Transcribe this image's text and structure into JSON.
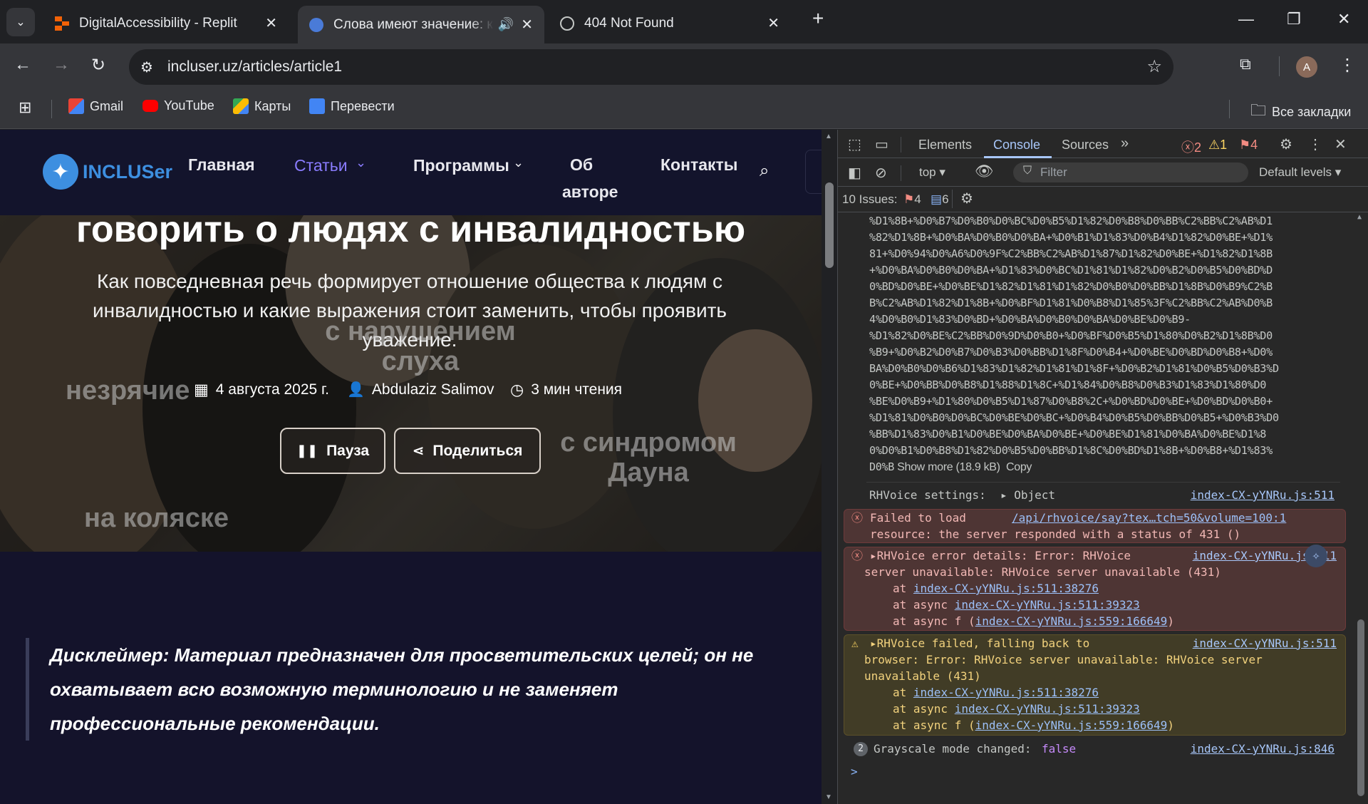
{
  "browser": {
    "tabs": [
      {
        "title": "DigitalAccessibility - Replit",
        "active": false
      },
      {
        "title": "Слова имеют значение: ка",
        "active": true
      },
      {
        "title": "404 Not Found",
        "active": false
      }
    ],
    "new_tab": "+",
    "url": "incluser.uz/articles/article1",
    "profile_initial": "A",
    "bookmarks": [
      "Gmail",
      "YouTube",
      "Карты",
      "Перевести"
    ],
    "all_bookmarks": "Все закладки"
  },
  "site": {
    "logo": "INCLUSer",
    "nav": [
      "Главная",
      "Статьи",
      "Программы",
      "Об",
      "авторе",
      "Контакты"
    ],
    "hero_title": "говорить о людях с инвалидностью",
    "hero_subtitle": "Как повседневная речь формирует отношение общества к людям с инвалидностью и какие выражения стоит заменить, чтобы проявить уважение.",
    "floating_words": [
      "с нарушением слуха",
      "незрячие",
      "с синдромом Дауна",
      "на коляске"
    ],
    "date": "4 августа 2025 г.",
    "author": "Abdulaziz Salimov",
    "read_time": "3 мин чтения",
    "pause_label": "Пауза",
    "share_label": "Поделиться",
    "disclaimer": "Дисклеймер: Материал предназначен для просветительских целей; он не охватывает всю возможную терминологию и не заменяет профессиональные рекомендации."
  },
  "devtools": {
    "tabs": [
      "Elements",
      "Console",
      "Sources"
    ],
    "active_tab": "Console",
    "error_count": "2",
    "warning_count": "1",
    "issue_badge": "4",
    "context": "top",
    "filter_placeholder": "Filter",
    "levels": "Default levels",
    "issues_label": "10 Issues:",
    "issues_errors": "4",
    "issues_info": "6",
    "encoded_lines": [
      "%D1%8B+%D0%B7%D0%B0%D0%BC%D0%B5%D1%82%D0%B8%D0%BB%C2%BB%C2%AB%D1",
      "%82%D1%8B+%D0%BA%D0%B0%D0%BA+%D0%B1%D1%83%D0%B4%D1%82%D0%BE+%D1%",
      "81+%D0%94%D0%A6%D0%9F%C2%BB%C2%AB%D1%87%D1%82%D0%BE+%D1%82%D1%8B",
      "+%D0%BA%D0%B0%D0%BA+%D1%83%D0%BC%D1%81%D1%82%D0%B2%D0%B5%D0%BD%D",
      "0%BD%D0%BE+%D0%BE%D1%82%D1%81%D1%82%D0%B0%D0%BB%D1%8B%D0%B9%C2%B",
      "B%C2%AB%D1%82%D1%8B+%D0%BF%D1%81%D0%B8%D1%85%3F%C2%BB%C2%AB%D0%B",
      "4%D0%B0%D1%83%D0%BD+%D0%BA%D0%B0%D0%BA%D0%BE%D0%B9-",
      "%D1%82%D0%BE%C2%BB%D0%9D%D0%B0+%D0%BF%D0%B5%D1%80%D0%B2%D1%8B%D0",
      "%B9+%D0%B2%D0%B7%D0%B3%D0%BB%D1%8F%D0%B4+%D0%BE%D0%BD%D0%B8+%D0%",
      "BA%D0%B0%D0%B6%D1%83%D1%82%D1%81%D1%8F+%D0%B2%D1%81%D0%B5%D0%B3%D",
      "0%BE+%D0%BB%D0%B8%D1%88%D1%8C+%D1%84%D0%B8%D0%B3%D1%83%D1%80%D0",
      "%BE%D0%B9+%D1%80%D0%B5%D1%87%D0%B8%2C+%D0%BD%D0%BE+%D0%BD%D0%B0+",
      "%D1%81%D0%B0%D0%BC%D0%BE%D0%BC+%D0%B4%D0%B5%D0%BB%D0%B5+%D0%B3%D0",
      "%BB%D1%83%D0%B1%D0%BE%D0%BA%D0%BE+%D0%BE%D1%81%D0%BA%D0%BE%D1%8",
      "0%D0%B1%D0%B8%D1%82%D0%B5%D0%BB%D1%8C%D0%BD%D1%8B+%D0%B8+%D1%83%"
    ],
    "encoded_tail": "D0%B",
    "show_more": "Show more (18.9 kB)",
    "copy": "Copy",
    "rh_settings": "RHVoice settings:",
    "rh_object": "Object",
    "src_511": "index-CX-yYNRu.js:511",
    "src_846": "index-CX-yYNRu.js:846",
    "failed_load_1": "Failed to load",
    "failed_load_url": "/api/rhvoice/say?tex…tch=50&volume=100:1",
    "failed_load_2": "resource: the server responded with a status of 431 ()",
    "err_details_1": "RHVoice error details: Error: RHVoice",
    "err_details_2": "server unavailable: RHVoice server unavailable (431)",
    "stack_at": "at",
    "stack_async": "at async",
    "stack_async_f": "at async f (",
    "stack1": "index-CX-yYNRu.js:511:38276",
    "stack2": "index-CX-yYNRu.js:511:39323",
    "stack3": "index-CX-yYNRu.js:559:166649",
    "warn_1": "RHVoice failed, falling back to",
    "warn_2": "browser: Error: RHVoice server unavailable: RHVoice server",
    "warn_3": "unavailable (431)",
    "gray_count": "2",
    "gray_label": "Grayscale mode changed:",
    "gray_value": "false",
    "prompt": ">"
  }
}
